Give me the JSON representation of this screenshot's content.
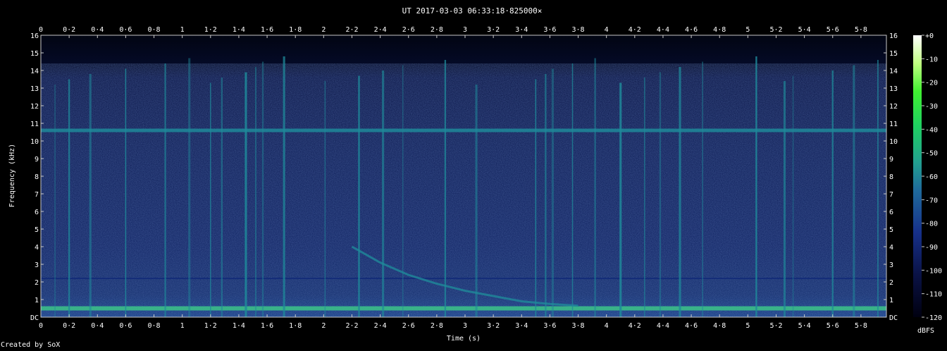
{
  "chart_data": {
    "type": "heatmap",
    "title": "UT 2017-03-03 06:33:18·825000×",
    "xlabel": "Time (s)",
    "ylabel": "Frequency (kHz)",
    "xlim": [
      0,
      5.98
    ],
    "ylim": [
      0,
      16
    ],
    "x_ticks": [
      "0",
      "0·2",
      "0·4",
      "0·6",
      "0·8",
      "1",
      "1·2",
      "1·4",
      "1·6",
      "1·8",
      "2",
      "2·2",
      "2·4",
      "2·6",
      "2·8",
      "3",
      "3·2",
      "3·4",
      "3·6",
      "3·8",
      "4",
      "4·2",
      "4·4",
      "4·6",
      "4·8",
      "5",
      "5·2",
      "5·4",
      "5·6",
      "5·8"
    ],
    "x_tick_values": [
      0,
      0.2,
      0.4,
      0.6,
      0.8,
      1,
      1.2,
      1.4,
      1.6,
      1.8,
      2,
      2.2,
      2.4,
      2.6,
      2.8,
      3,
      3.2,
      3.4,
      3.6,
      3.8,
      4,
      4.2,
      4.4,
      4.6,
      4.8,
      5,
      5.2,
      5.4,
      5.6,
      5.8
    ],
    "y_ticks": [
      "DC",
      "1",
      "2",
      "3",
      "4",
      "5",
      "6",
      "7",
      "8",
      "9",
      "10",
      "11",
      "12",
      "13",
      "14",
      "15",
      "16"
    ],
    "y_tick_values": [
      0,
      1,
      2,
      3,
      4,
      5,
      6,
      7,
      8,
      9,
      10,
      11,
      12,
      13,
      14,
      15,
      16
    ],
    "colorbar": {
      "label": "dBFS",
      "ticks": [
        "+0",
        "-10",
        "-20",
        "-30",
        "-40",
        "-50",
        "-60",
        "-70",
        "-80",
        "-90",
        "-100",
        "-110",
        "-120"
      ],
      "tick_values": [
        0,
        -10,
        -20,
        -30,
        -40,
        -50,
        -60,
        -70,
        -80,
        -90,
        -100,
        -110,
        -120
      ],
      "range": [
        -120,
        0
      ]
    },
    "colors": {
      "background": "#000000",
      "plot_floor": "#0a1245",
      "low": "#122a78",
      "mid": "#1f8a9a",
      "high": "#3cc488"
    },
    "features": {
      "horizontal_lines_khz": [
        10.6,
        0.5,
        2.2
      ],
      "vertical_transients_s": [
        0.1,
        0.2,
        0.35,
        0.6,
        0.88,
        1.05,
        1.2,
        1.28,
        1.45,
        1.52,
        1.57,
        1.72,
        2.01,
        2.25,
        2.42,
        2.56,
        2.86,
        3.08,
        3.5,
        3.57,
        3.62,
        3.76,
        3.92,
        4.1,
        4.27,
        4.38,
        4.52,
        4.68,
        5.06,
        5.26,
        5.32,
        5.6,
        5.75,
        5.92
      ],
      "whistler_curve": [
        [
          2.2,
          4.0
        ],
        [
          2.4,
          3.1
        ],
        [
          2.6,
          2.4
        ],
        [
          2.8,
          1.9
        ],
        [
          3.0,
          1.5
        ],
        [
          3.2,
          1.2
        ],
        [
          3.4,
          0.9
        ],
        [
          3.6,
          0.75
        ],
        [
          3.8,
          0.65
        ]
      ]
    }
  },
  "footer": {
    "credit": "Created by SoX"
  }
}
